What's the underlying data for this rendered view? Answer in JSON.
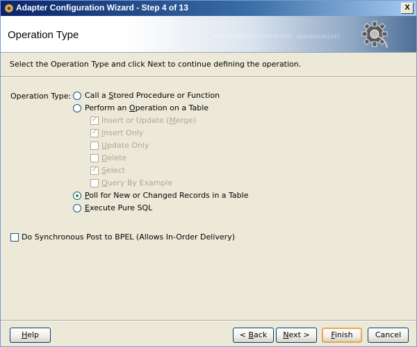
{
  "window": {
    "title": "Adapter Configuration Wizard - Step 4 of 13",
    "close_label": "X"
  },
  "banner": {
    "title": "Operation Type",
    "binary_text": "010110101010101101010101 0101010101101"
  },
  "instruction": "Select the Operation Type and click Next to continue defining the operation.",
  "operation_type_label": "Operation Type:",
  "radio_options": [
    {
      "pre": "Call a ",
      "mnemonic": "S",
      "post": "tored Procedure or Function",
      "selected": false
    },
    {
      "pre": "Perform an ",
      "mnemonic": "O",
      "post": "peration on a Table",
      "selected": false
    },
    {
      "pre": "",
      "mnemonic": "P",
      "post": "oll for New or Changed Records in a Table",
      "selected": true
    },
    {
      "pre": "",
      "mnemonic": "E",
      "post": "xecute Pure SQL",
      "selected": false
    }
  ],
  "table_operations": [
    {
      "pre": "Insert or Update (",
      "mnemonic": "M",
      "post": "erge)",
      "checked": true
    },
    {
      "pre": "",
      "mnemonic": "I",
      "post": "nsert Only",
      "checked": true
    },
    {
      "pre": "",
      "mnemonic": "U",
      "post": "pdate Only",
      "checked": false
    },
    {
      "pre": "",
      "mnemonic": "D",
      "post": "elete",
      "checked": false
    },
    {
      "pre": "",
      "mnemonic": "S",
      "post": "elect",
      "checked": true
    },
    {
      "pre": "",
      "mnemonic": "Q",
      "post": "uery By Example",
      "checked": false
    }
  ],
  "sync_post": {
    "pre": "Do Synchronous Post to BPEL (Allows In-Order Delivery)",
    "checked": false
  },
  "buttons": {
    "help": {
      "pre": "",
      "mnemonic": "H",
      "post": "elp"
    },
    "back": {
      "pre": "< ",
      "mnemonic": "B",
      "post": "ack"
    },
    "next": {
      "pre": "",
      "mnemonic": "N",
      "post": "ext >"
    },
    "finish": {
      "pre": "",
      "mnemonic": "F",
      "post": "inish"
    },
    "cancel": {
      "pre": "Cancel",
      "mnemonic": "",
      "post": ""
    }
  }
}
